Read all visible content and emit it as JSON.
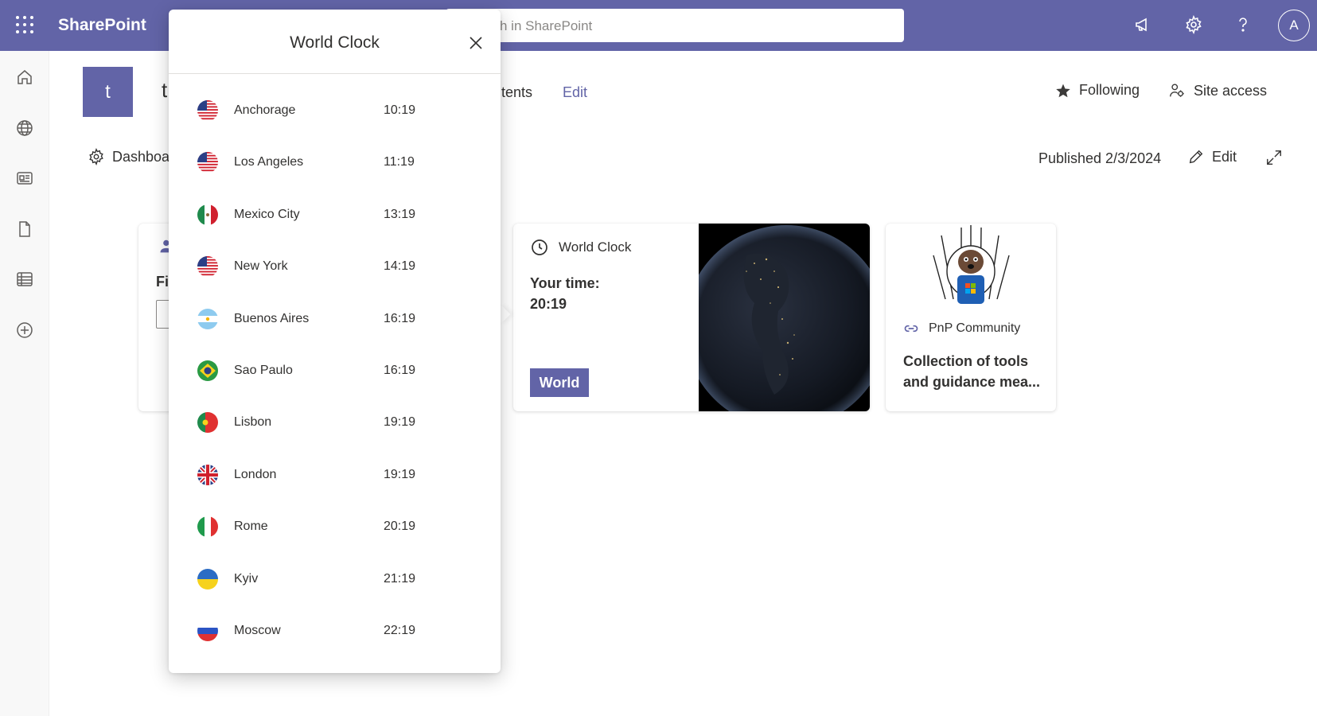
{
  "suitebar": {
    "brand": "SharePoint",
    "search_placeholder": "h in SharePoint",
    "avatar_initial": "A"
  },
  "site": {
    "logo_letter": "t",
    "title_fragment": "t",
    "nav": [
      {
        "label": "tents"
      },
      {
        "label": "Edit"
      }
    ],
    "following_label": "Following",
    "site_access_label": "Site access"
  },
  "commandbar": {
    "dashboard_label": "Dashboa",
    "published": "Published 2/3/2024",
    "edit_label": "Edit"
  },
  "cards": {
    "left_fragment": "Fi",
    "world_clock": {
      "title": "World Clock",
      "your_time_label": "Your time:",
      "your_time_value": "20:19",
      "button_label": "World"
    },
    "pnp": {
      "link_label": "PnP Community",
      "description": "Collection of tools and guidance mea..."
    }
  },
  "popup": {
    "title": "World Clock",
    "cities": [
      {
        "name": "Anchorage",
        "time": "10:19",
        "flag": "us"
      },
      {
        "name": "Los Angeles",
        "time": "11:19",
        "flag": "us"
      },
      {
        "name": "Mexico City",
        "time": "13:19",
        "flag": "mx"
      },
      {
        "name": "New York",
        "time": "14:19",
        "flag": "us"
      },
      {
        "name": "Buenos Aires",
        "time": "16:19",
        "flag": "ar"
      },
      {
        "name": "Sao Paulo",
        "time": "16:19",
        "flag": "br"
      },
      {
        "name": "Lisbon",
        "time": "19:19",
        "flag": "pt"
      },
      {
        "name": "London",
        "time": "19:19",
        "flag": "gb"
      },
      {
        "name": "Rome",
        "time": "20:19",
        "flag": "it"
      },
      {
        "name": "Kyiv",
        "time": "21:19",
        "flag": "ua"
      },
      {
        "name": "Moscow",
        "time": "22:19",
        "flag": "ru"
      }
    ]
  },
  "colors": {
    "brand": "#6264a7",
    "text": "#323130"
  }
}
